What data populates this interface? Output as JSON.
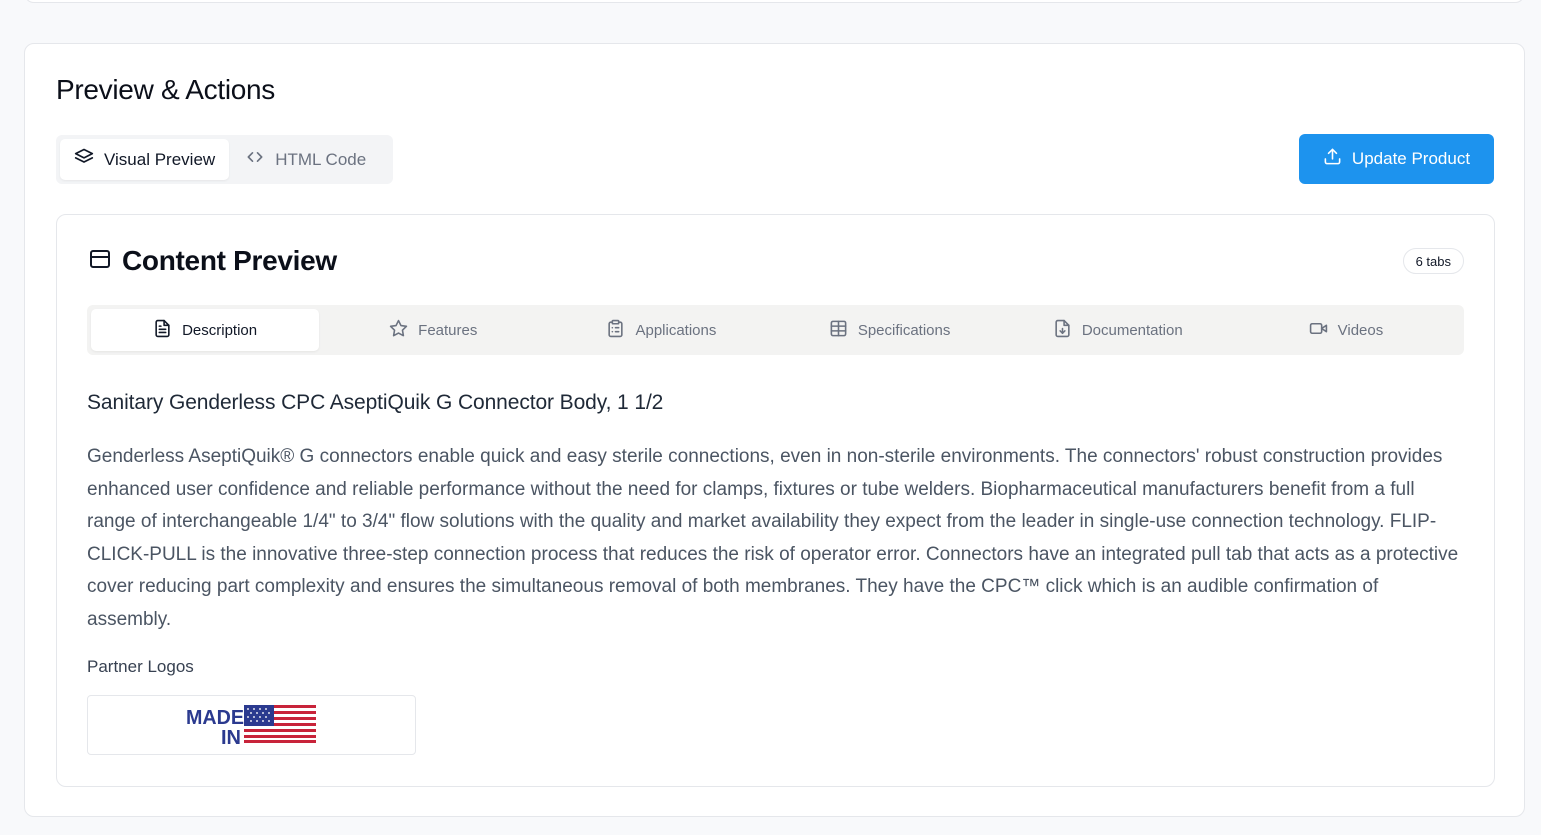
{
  "section": {
    "title": "Preview & Actions"
  },
  "view_toggle": {
    "visual_label": "Visual Preview",
    "html_label": "HTML Code",
    "selected": "Visual Preview"
  },
  "actions": {
    "update_label": "Update Product"
  },
  "preview": {
    "title": "Content Preview",
    "badge": "6 tabs",
    "tabs": [
      {
        "label": "Description",
        "icon": "file-text-icon",
        "active": true
      },
      {
        "label": "Features",
        "icon": "star-icon",
        "active": false
      },
      {
        "label": "Applications",
        "icon": "clipboard-icon",
        "active": false
      },
      {
        "label": "Specifications",
        "icon": "table-icon",
        "active": false
      },
      {
        "label": "Documentation",
        "icon": "file-download-icon",
        "active": false
      },
      {
        "label": "Videos",
        "icon": "video-icon",
        "active": false
      }
    ]
  },
  "product": {
    "title": "Sanitary Genderless CPC AseptiQuik G Connector Body, 1 1/2",
    "description": "Genderless AseptiQuik® G connectors enable quick and easy sterile connections, even in non-sterile environments. The connectors' robust construction provides enhanced user confidence and reliable performance without the need for clamps, fixtures or tube welders. Biopharmaceutical manufacturers benefit from a full range of interchangeable 1/4\" to 3/4\" flow solutions with the quality and market availability they expect from the leader in single-use connection technology. FLIP-CLICK-PULL is the innovative three-step connection process that reduces the risk of operator error. Connectors have an integrated pull tab that acts as a protective cover reducing part complexity and ensures the simultaneous removal of both membranes. They have the CPC™ click which is an audible confirmation of assembly.",
    "partner_heading": "Partner Logos",
    "partner_logo_text": [
      "MADE",
      "IN"
    ]
  },
  "colors": {
    "accent": "#1d93ee",
    "flag_red": "#c8233a",
    "flag_blue": "#2b3a8f"
  }
}
